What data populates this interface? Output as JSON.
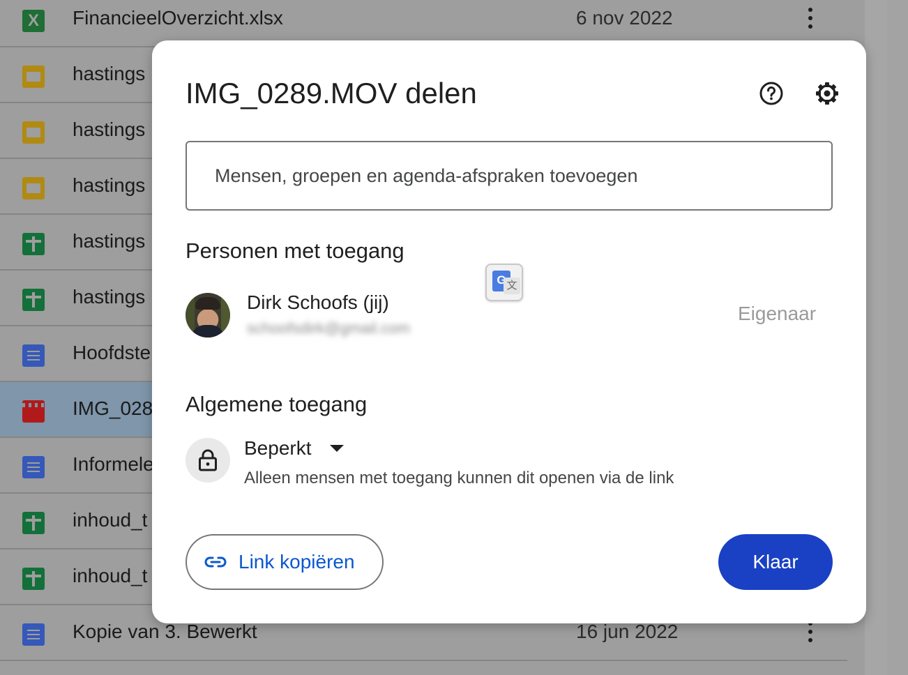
{
  "file_list": {
    "rows": [
      {
        "name": "FinancieelOverzicht.xlsx",
        "date": "6 nov 2022",
        "icon": "excel-icon"
      },
      {
        "name": "hastings",
        "date": "",
        "icon": "slides-icon"
      },
      {
        "name": "hastings",
        "date": "",
        "icon": "slides-icon"
      },
      {
        "name": "hastings",
        "date": "",
        "icon": "slides-icon"
      },
      {
        "name": "hastings",
        "date": "",
        "icon": "sheets-icon"
      },
      {
        "name": "hastings",
        "date": "",
        "icon": "sheets-icon"
      },
      {
        "name": "Hoofdste",
        "date": "",
        "icon": "docs-icon"
      },
      {
        "name": "IMG_028",
        "date": "",
        "icon": "video-icon"
      },
      {
        "name": "Informele",
        "date": "",
        "icon": "docs-icon"
      },
      {
        "name": "inhoud_t",
        "date": "",
        "icon": "sheets-icon"
      },
      {
        "name": "inhoud_t",
        "date": "",
        "icon": "sheets-icon"
      },
      {
        "name": "Kopie van 3. Bewerkt",
        "date": "16 jun 2022",
        "icon": "docs-icon"
      }
    ]
  },
  "dialog": {
    "title": "IMG_0289.MOV delen",
    "help_icon": "help-icon",
    "settings_icon": "gear-icon",
    "add_placeholder": "Mensen, groepen en agenda-afspraken toevoegen",
    "people_section_title": "Personen met toegang",
    "person": {
      "name": "Dirk Schoofs (jij)",
      "email": "schoofsdirk@gmail.com",
      "role": "Eigenaar"
    },
    "general_access_title": "Algemene toegang",
    "access": {
      "level": "Beperkt",
      "description": "Alleen mensen met toegang kunnen dit openen via de link"
    },
    "copy_link_label": "Link kopiëren",
    "done_label": "Klaar"
  },
  "colors": {
    "primary_button": "#1a40c4",
    "link_text": "#0b57d0",
    "overlay": "#9e9e9e",
    "selected_row": "#7f96ab"
  }
}
